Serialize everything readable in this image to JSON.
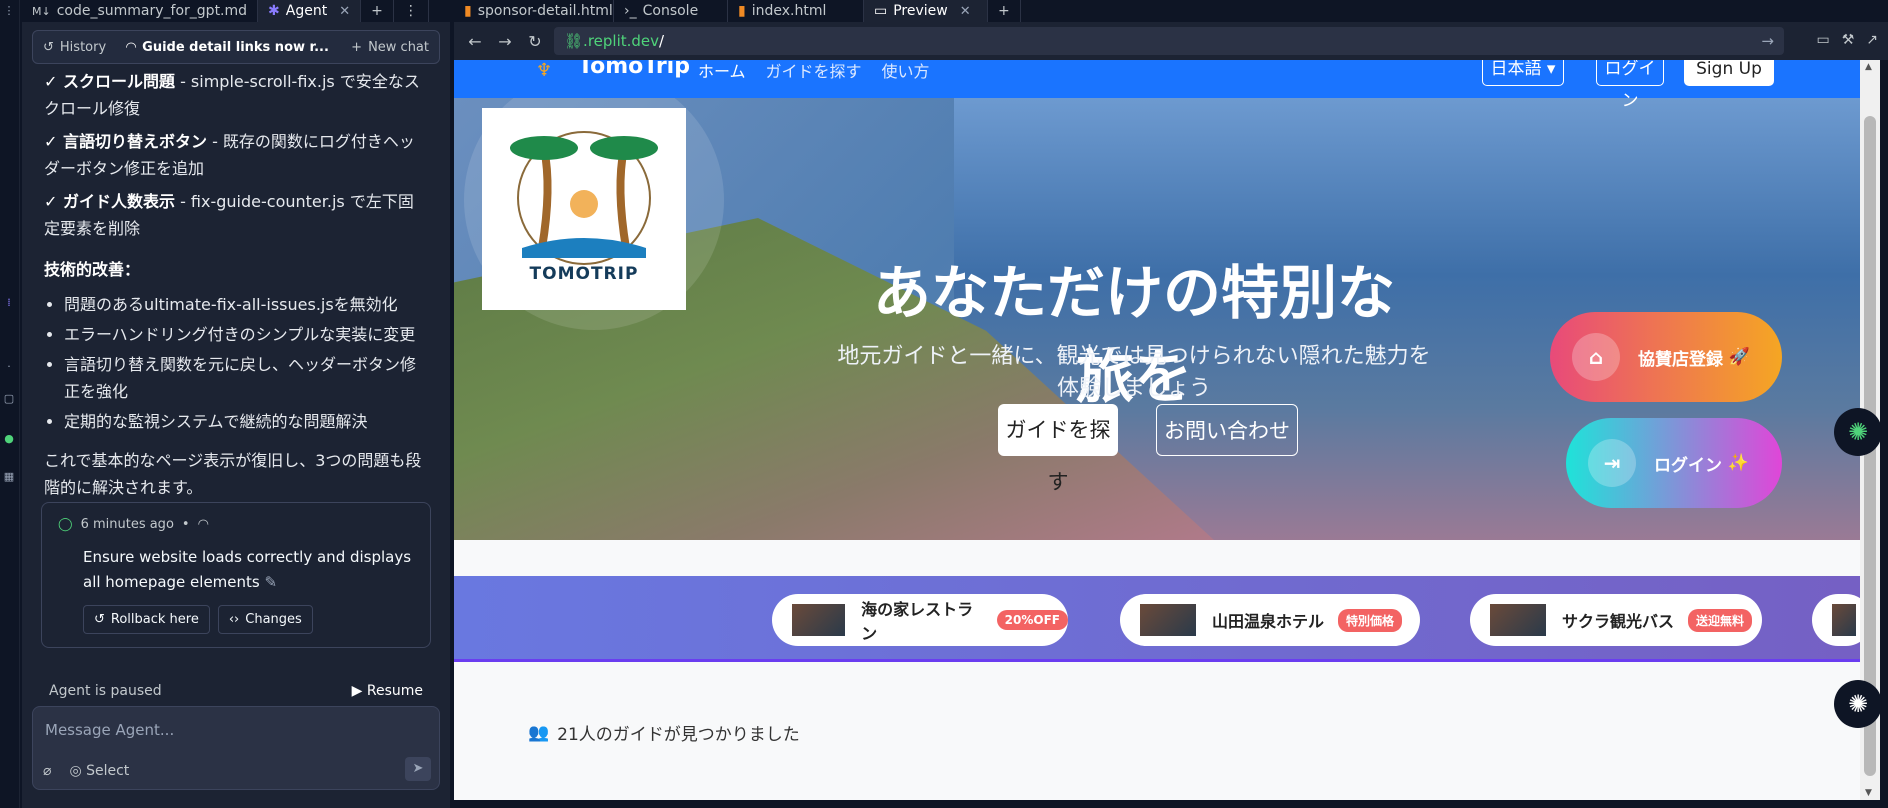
{
  "left_tabs": [
    {
      "label": "code_summary_for_gpt.md"
    },
    {
      "label": "Agent"
    }
  ],
  "agent_toolbar": {
    "history": "History",
    "current_chat": "Guide detail links now r...",
    "new_chat": "New chat"
  },
  "chat": {
    "fix1_title": "✓ スクロール問題",
    "fix1_text": " - simple-scroll-fix.js で安全なスクロール修復",
    "fix2_title": "✓ 言語切り替えボタン",
    "fix2_text": " - 既存の関数にログ付きヘッダーボタン修正を追加",
    "fix3_title": "✓ ガイド人数表示",
    "fix3_text": " - fix-guide-counter.js で左下固定要素を削除",
    "tech_heading": "技術的改善：",
    "bullets": [
      "問題のあるultimate-fix-all-issues.jsを無効化",
      "エラーハンドリング付きのシンプルな実装に変更",
      "言語切り替え関数を元に戻し、ヘッダーボタン修正を強化",
      "定期的な監視システムで継続的な問題解決"
    ],
    "closing": "これで基本的なページ表示が復旧し、3つの問題も段階的に解決されます。"
  },
  "checkpoint": {
    "time": "6 minutes ago",
    "dot": "•",
    "message": "Ensure website loads correctly and displays all homepage elements",
    "rollback": "Rollback here",
    "changes": "Changes"
  },
  "status": {
    "paused": "Agent is paused",
    "resume": "Resume"
  },
  "composer": {
    "placeholder": "Message Agent...",
    "select": "Select"
  },
  "right_tabs": [
    {
      "label": "sponsor-detail.html"
    },
    {
      "label": "Console"
    },
    {
      "label": "index.html"
    },
    {
      "label": "Preview"
    }
  ],
  "url": {
    "domain": ".replit.dev",
    "path": "/"
  },
  "site": {
    "brand": "TomoTrip",
    "nav": [
      "ホーム",
      "ガイドを探す",
      "使い方"
    ],
    "lang": "日本語",
    "login": "ログイン",
    "signup": "Sign Up",
    "logo_text": "TOMOTRIP",
    "hero_title": "あなただけの特別な旅を",
    "hero_sub": "地元ガイドと一緒に、観光では見つけられない隠れた魅力を体験しましょう",
    "find_guide": "ガイドを探す",
    "contact": "お問い合わせ",
    "sponsor_register": "協賛店登録",
    "sponsor_emoji": "🚀",
    "login_pill": "ログイン",
    "login_emoji": "✨",
    "shops": [
      {
        "name": "海の家レストラン",
        "badge": "20%OFF"
      },
      {
        "name": "山田温泉ホテル",
        "badge": "特別価格"
      },
      {
        "name": "サクラ観光バス",
        "badge": "送迎無料"
      }
    ],
    "guide_count": "21人のガイドが見つかりました"
  }
}
